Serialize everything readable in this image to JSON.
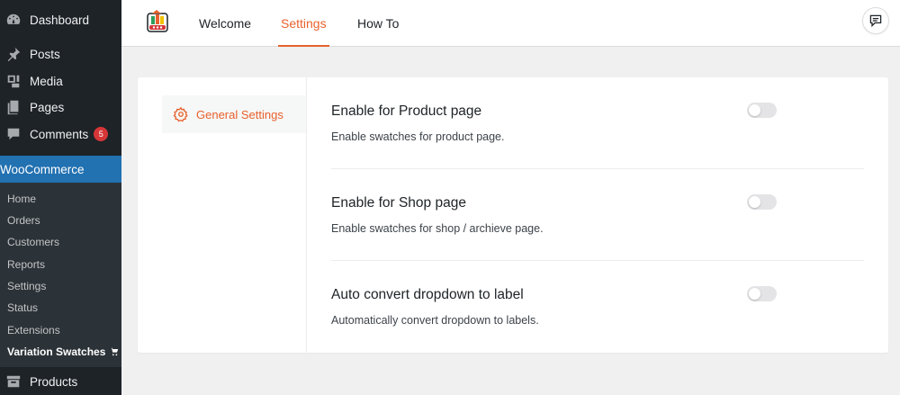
{
  "sidebar": {
    "items": [
      {
        "label": "Dashboard",
        "icon": "dashboard-icon"
      },
      {
        "label": "Posts",
        "icon": "pushpin-icon"
      },
      {
        "label": "Media",
        "icon": "media-icon"
      },
      {
        "label": "Pages",
        "icon": "pages-icon"
      },
      {
        "label": "Comments",
        "icon": "comments-icon",
        "badge": "5"
      }
    ],
    "woocommerce": {
      "label": "WooCommerce",
      "icon": "woo-icon"
    },
    "submenu": [
      "Home",
      "Orders",
      "Customers",
      "Reports",
      "Settings",
      "Status",
      "Extensions",
      "Variation Swatches"
    ],
    "products": {
      "label": "Products",
      "icon": "archive-icon"
    }
  },
  "header": {
    "tabs": [
      {
        "label": "Welcome"
      },
      {
        "label": "Settings",
        "active": true
      },
      {
        "label": "How To"
      }
    ],
    "chat_icon": "feedback-icon"
  },
  "panel": {
    "nav_label": "General Settings",
    "settings": [
      {
        "title": "Enable for Product page",
        "desc": "Enable swatches for product page.",
        "enabled": false
      },
      {
        "title": "Enable for Shop page",
        "desc": "Enable swatches for shop / archieve page.",
        "enabled": false
      },
      {
        "title": "Auto convert dropdown to label",
        "desc": "Automatically convert dropdown to labels.",
        "enabled": false
      }
    ]
  },
  "colors": {
    "accent": "#e8612c",
    "sidebar": "#1d2327",
    "active_menu": "#2271b1",
    "badge": "#d63638"
  }
}
